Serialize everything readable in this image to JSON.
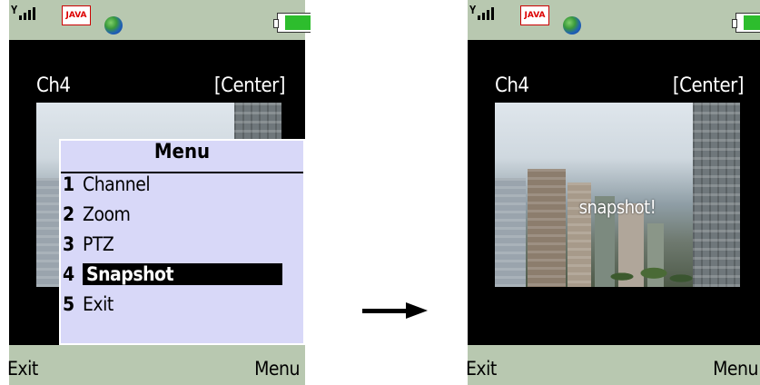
{
  "left_screen": {
    "status_bar": {
      "java_badge": "JAVA",
      "icons": [
        "signal-icon",
        "java-icon",
        "globe-icon",
        "battery-icon"
      ],
      "battery_level": 0.8
    },
    "channel": "Ch4",
    "mode": "[Center]",
    "menu": {
      "title": "Menu",
      "items": [
        {
          "number": "1",
          "label": "Channel"
        },
        {
          "number": "2",
          "label": "Zoom"
        },
        {
          "number": "3",
          "label": "PTZ"
        },
        {
          "number": "4",
          "label": "Snapshot",
          "selected": true
        },
        {
          "number": "5",
          "label": "Exit"
        }
      ]
    },
    "softkeys": {
      "left": "Exit",
      "right": "Menu"
    }
  },
  "right_screen": {
    "status_bar": {
      "java_badge": "JAVA",
      "icons": [
        "signal-icon",
        "java-icon",
        "globe-icon",
        "battery-icon"
      ],
      "battery_level": 0.8
    },
    "channel": "Ch4",
    "mode": "[Center]",
    "overlay_text": "snapshot!",
    "softkeys": {
      "left": "Exit",
      "right": "Menu"
    }
  },
  "transition_icon": "right-arrow-icon",
  "colors": {
    "status_bar": "#b8c8b0",
    "menu_bg": "#d8d8f8",
    "battery": "#2dbd2d",
    "screen_bg": "#000000"
  }
}
